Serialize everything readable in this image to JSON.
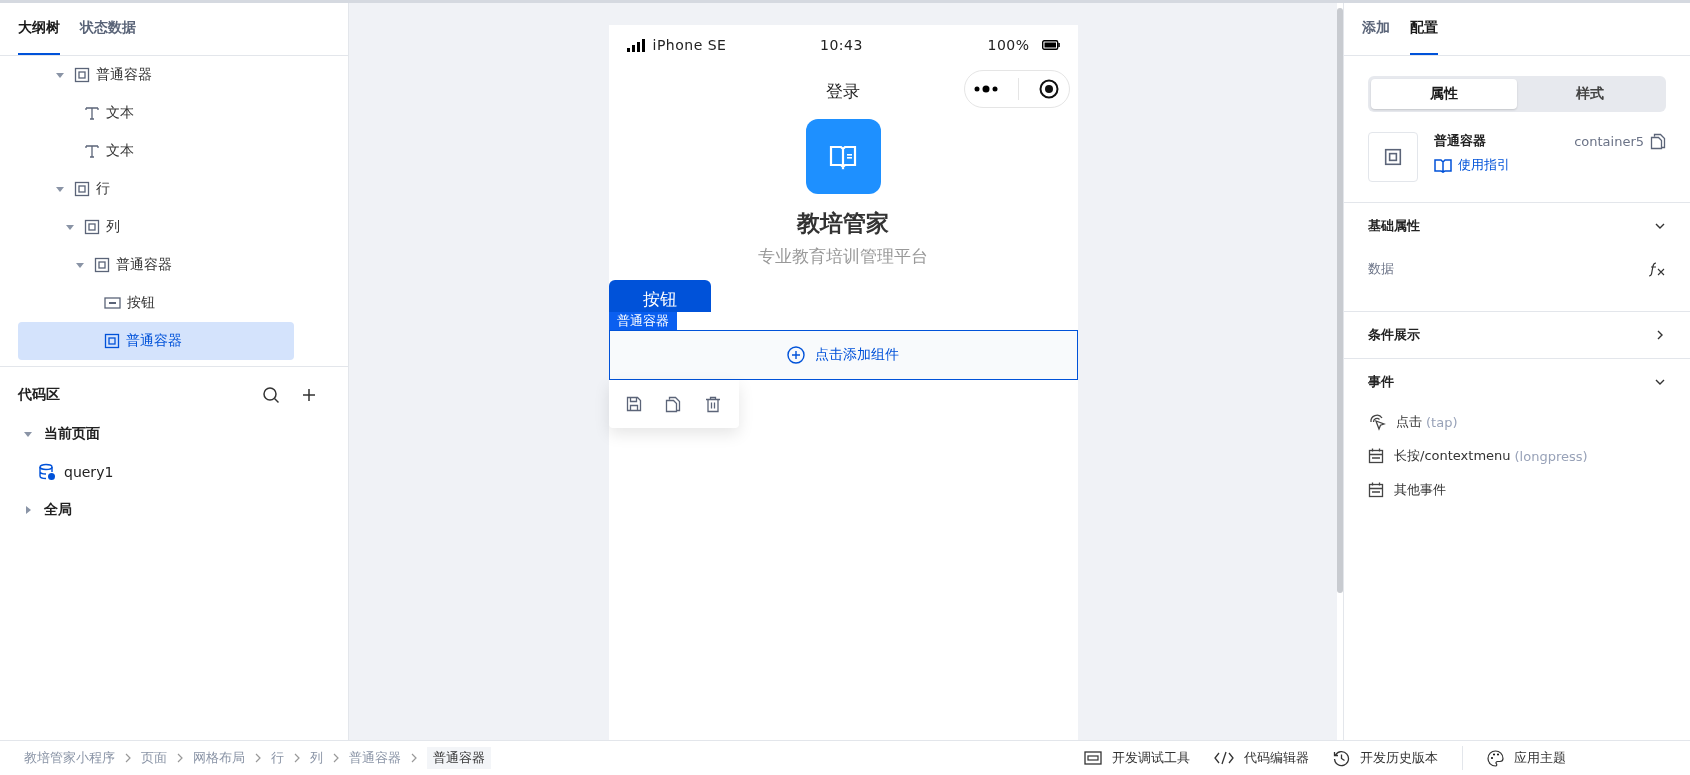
{
  "left_panel": {
    "tabs": [
      {
        "label": "大纲树",
        "selected": true
      },
      {
        "label": "状态数据",
        "selected": false
      }
    ],
    "outline": [
      {
        "label": "普通容器",
        "kind": "container",
        "expanded": true,
        "selected": false,
        "children": [
          {
            "label": "文本",
            "kind": "text",
            "selected": false
          },
          {
            "label": "文本",
            "kind": "text",
            "selected": false
          }
        ]
      },
      {
        "label": "行",
        "kind": "container",
        "expanded": true,
        "selected": false,
        "children": [
          {
            "label": "列",
            "kind": "container",
            "expanded": true,
            "selected": false,
            "children": [
              {
                "label": "普通容器",
                "kind": "container",
                "expanded": true,
                "selected": false,
                "children": [
                  {
                    "label": "按钮",
                    "kind": "button",
                    "selected": false
                  },
                  {
                    "label": "普通容器",
                    "kind": "container",
                    "selected": true
                  }
                ]
              }
            ]
          }
        ]
      }
    ],
    "code_area": {
      "title": "代码区",
      "groups": [
        {
          "label": "当前页面",
          "expanded": true,
          "items": [
            {
              "label": "query1"
            }
          ]
        },
        {
          "label": "全局",
          "expanded": false
        }
      ]
    }
  },
  "phone": {
    "status_bar": {
      "device": "iPhone SE",
      "time": "10:43",
      "battery": "100%"
    },
    "nav_title": "登录",
    "app_name": "教培管家",
    "tagline": "专业教育培训管理平台",
    "button": "按钮",
    "selection_label": "普通容器",
    "add_component": "点击添加组件"
  },
  "right_panel": {
    "tabs": [
      {
        "label": "添加",
        "selected": false
      },
      {
        "label": "配置",
        "selected": true
      }
    ],
    "mode_switch": [
      {
        "label": "属性",
        "selected": true
      },
      {
        "label": "样式",
        "selected": false
      }
    ],
    "component": {
      "name": "普通容器",
      "id": "container5",
      "guide_link": "使用指引"
    },
    "sections": [
      {
        "title": "基础属性",
        "expanded": true,
        "kind": "fields",
        "items": [
          {
            "label": "数据"
          }
        ]
      },
      {
        "title": "条件展示",
        "expanded": false
      },
      {
        "title": "事件",
        "expanded": true,
        "kind": "events",
        "items": [
          {
            "label": "点击",
            "hint": "(tap)",
            "kind": "tap"
          },
          {
            "label": "长按/contextmenu",
            "hint": "(longpress)",
            "kind": "event"
          },
          {
            "label": "其他事件",
            "kind": "event"
          }
        ]
      }
    ]
  },
  "status_bar": {
    "breadcrumbs": [
      {
        "label": "教培管家小程序",
        "selected": false
      },
      {
        "label": "页面",
        "selected": false
      },
      {
        "label": "网格布局",
        "selected": false
      },
      {
        "label": "行",
        "selected": false
      },
      {
        "label": "列",
        "selected": false
      },
      {
        "label": "普通容器",
        "selected": false
      },
      {
        "label": "普通容器",
        "selected": true
      }
    ],
    "tools": [
      {
        "label": "开发调试工具",
        "kind": "debug"
      },
      {
        "label": "代码编辑器",
        "kind": "code"
      },
      {
        "label": "开发历史版本",
        "kind": "history"
      },
      {
        "label": "应用主题",
        "kind": "theme"
      }
    ]
  }
}
